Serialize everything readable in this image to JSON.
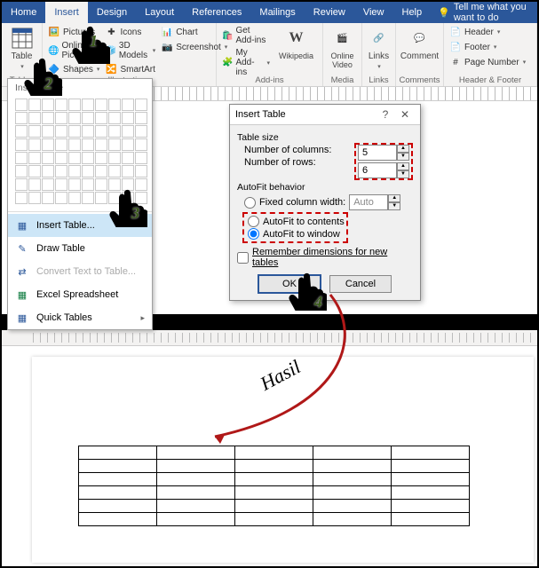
{
  "tabs": {
    "home": "Home",
    "insert": "Insert",
    "design": "Design",
    "layout": "Layout",
    "references": "References",
    "mailings": "Mailings",
    "review": "Review",
    "view": "View",
    "help": "Help",
    "tell": "Tell me what you want to do"
  },
  "ribbon": {
    "table": "Table",
    "tables": "Tables",
    "pictures": "Pictures",
    "online_pictures": "Online Pictures",
    "shapes": "Shapes",
    "icons": "Icons",
    "models3d": "3D Models",
    "smartart": "SmartArt",
    "chart": "Chart",
    "screenshot": "Screenshot",
    "illustrations": "Illustrations",
    "getaddins": "Get Add-ins",
    "myaddins": "My Add-ins",
    "wikipedia": "Wikipedia",
    "addins": "Add-ins",
    "onlinevideo": "Online\nVideo",
    "media": "Media",
    "links": "Links",
    "comment": "Comment",
    "comments": "Comments",
    "header": "Header",
    "footer": "Footer",
    "pagenum": "Page Number",
    "hf": "Header & Footer"
  },
  "tablemenu": {
    "title": "Insert Table",
    "insert": "Insert Table...",
    "draw": "Draw Table",
    "convert": "Convert Text to Table...",
    "excel": "Excel Spreadsheet",
    "quick": "Quick Tables"
  },
  "dialog": {
    "title": "Insert Table",
    "help": "?",
    "close": "✕",
    "tablesize": "Table size",
    "ncols": "Number of columns:",
    "nrows": "Number of rows:",
    "cols": "5",
    "rows": "6",
    "autofit": "AutoFit behavior",
    "fixed": "Fixed column width:",
    "fxval": "Auto",
    "contents": "AutoFit to contents",
    "window": "AutoFit to window",
    "remember": "Remember dimensions for new tables",
    "ok": "OK",
    "cancel": "Cancel"
  },
  "labels": {
    "n1": "1",
    "n2": "2",
    "n3": "3",
    "n4": "4",
    "hasil": "Hasil"
  },
  "chart_data": {
    "type": "table",
    "description": "Resulting inserted table in document",
    "columns": 5,
    "rows": 6,
    "values": [
      [
        "",
        "",
        "",
        "",
        ""
      ],
      [
        "",
        "",
        "",
        "",
        ""
      ],
      [
        "",
        "",
        "",
        "",
        ""
      ],
      [
        "",
        "",
        "",
        "",
        ""
      ],
      [
        "",
        "",
        "",
        "",
        ""
      ],
      [
        "",
        "",
        "",
        "",
        ""
      ]
    ]
  }
}
